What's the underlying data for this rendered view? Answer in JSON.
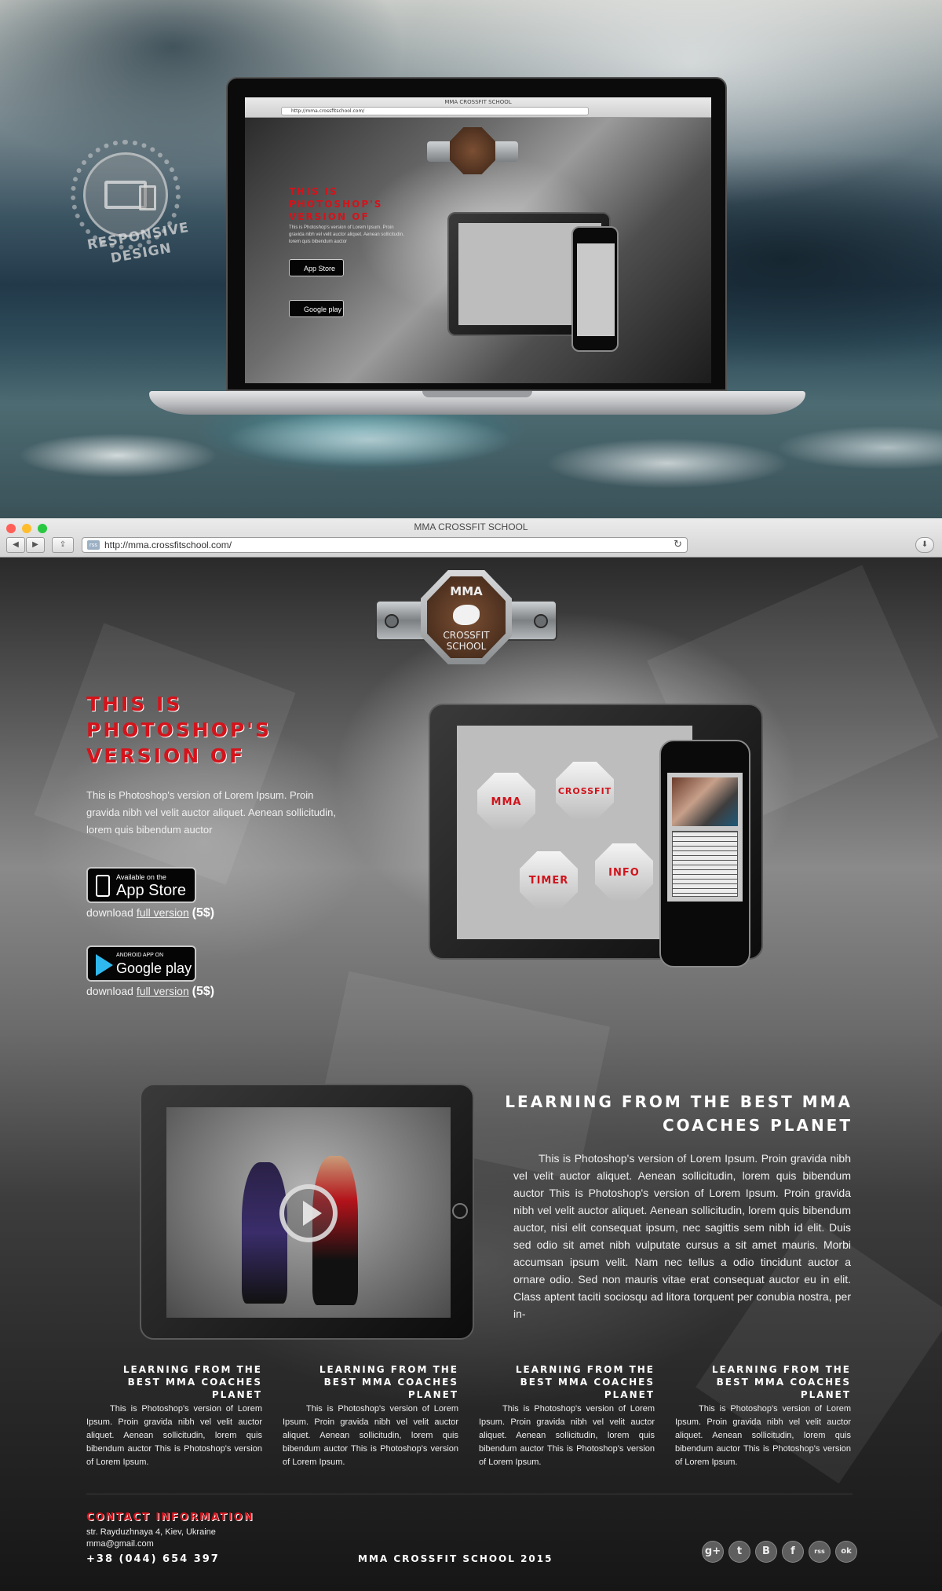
{
  "browser": {
    "title": "MMA CROSSFIT SCHOOL",
    "url": "http://mma.crossfitschool.com/",
    "back_icon": "◀",
    "forward_icon": "▶",
    "share_icon": "⇪",
    "reload_icon": "↻",
    "download_icon": "⬇",
    "traffic_colors": [
      "#ff5f57",
      "#ffbd2e",
      "#28c940"
    ]
  },
  "hero": {
    "badge_text": "RESPONSIVE DESIGN",
    "mini_title": "MMA CROSSFIT SCHOOL",
    "mini_url": "http://mma.crossfitschool.com/"
  },
  "logo": {
    "top": "MMA",
    "line1": "CROSSFIT",
    "line2": "SCHOOL"
  },
  "intro": {
    "heading": "THIS IS PHOTOSHOP'S VERSION  OF",
    "text": "This is Photoshop's version  of Lorem Ipsum. Proin gravida nibh vel velit auctor aliquet. Aenean sollicitudin, lorem quis bibendum auctor"
  },
  "stores": {
    "appstore_small": "Available on the",
    "appstore_big": "App Store",
    "google_small": "ANDROID APP ON",
    "google_big": "Google play",
    "download_prefix": "download ",
    "download_link": "full version",
    "price": "(5$)"
  },
  "app_screen": {
    "buttons": [
      "MMA",
      "CROSSFIT",
      "TIMER",
      "INFO"
    ],
    "phone_text": "Lorem Ipsum dolor sit amet, consectetur adipiscing elit."
  },
  "learning": {
    "heading": "LEARNING FROM THE BEST MMA COACHES PLANET",
    "text": "This is Photoshop's version  of Lorem Ipsum. Proin gravida nibh vel velit auctor aliquet. Aenean sollicitudin, lorem quis bibendum auctor This is Photoshop's version  of Lorem Ipsum. Proin gravida nibh vel velit auctor aliquet. Aenean sollicitudin, lorem quis bibendum auctor, nisi elit consequat ipsum, nec sagittis sem nibh id elit. Duis sed odio sit amet nibh vulputate cursus a sit amet mauris. Morbi accumsan ipsum velit. Nam nec tellus a odio tincidunt auctor a ornare odio. Sed non mauris vitae erat consequat auctor eu in elit. Class aptent taciti sociosqu ad litora torquent per conubia nostra, per in-"
  },
  "columns": [
    {
      "title": "LEARNING FROM THE BEST MMA COACHES PLANET",
      "text": "This is Photoshop's version  of Lorem Ipsum. Proin gravida nibh vel velit auctor aliquet. Aenean sollicitudin, lorem quis bibendum auctor This is Photoshop's version  of Lorem Ipsum."
    },
    {
      "title": "LEARNING FROM THE BEST MMA COACHES PLANET",
      "text": "This is Photoshop's version  of Lorem Ipsum. Proin gravida nibh vel velit auctor aliquet. Aenean sollicitudin, lorem quis bibendum auctor This is Photoshop's version  of Lorem Ipsum."
    },
    {
      "title": "LEARNING FROM THE BEST MMA COACHES PLANET",
      "text": "This is Photoshop's version  of Lorem Ipsum. Proin gravida nibh vel velit auctor aliquet. Aenean sollicitudin, lorem quis bibendum auctor This is Photoshop's version  of Lorem Ipsum."
    },
    {
      "title": "LEARNING FROM THE BEST MMA COACHES PLANET",
      "text": "This is Photoshop's version  of Lorem Ipsum. Proin gravida nibh vel velit auctor aliquet. Aenean sollicitudin, lorem quis bibendum auctor This is Photoshop's version  of Lorem Ipsum."
    }
  ],
  "footer": {
    "contact_heading": "CONTACT INFORMATION",
    "address": "str. Rayduzhnaya 4, Kiev, Ukraine",
    "email": "mma@gmail.com",
    "phone": "+38 (044) 654 397",
    "copyright": "MMA CROSSFIT SCHOOL 2015",
    "social": [
      "g+",
      "t",
      "B",
      "f",
      "rss",
      "ok"
    ]
  },
  "colors": {
    "accent_red": "#d4131b",
    "page_dark": "#1a1a1a"
  }
}
